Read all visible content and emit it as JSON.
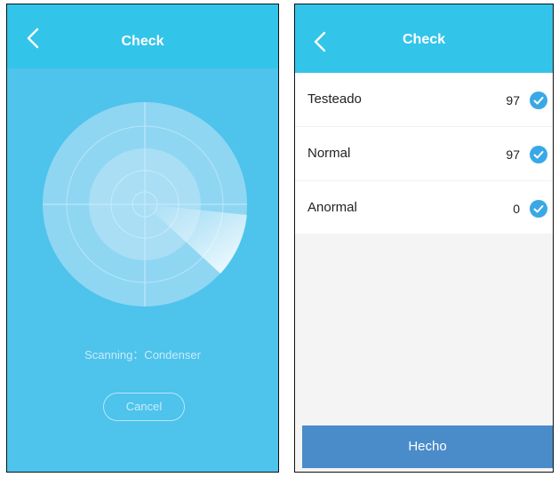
{
  "theme": {
    "header_color": "#33c4ea",
    "scan_bg_color": "#4ec3ec",
    "check_color": "#3aa8e6",
    "done_button_color": "#4a8cc9"
  },
  "scan_screen": {
    "back_icon": "chevron-left-icon",
    "title": "Check",
    "status_text": "Scanning：Condenser",
    "cancel_label": "Cancel"
  },
  "result_screen": {
    "back_icon": "chevron-left-icon",
    "title": "Check",
    "rows": [
      {
        "label": "Testeado",
        "value": "97",
        "icon": "check-circle-icon"
      },
      {
        "label": "Normal",
        "value": "97",
        "icon": "check-circle-icon"
      },
      {
        "label": "Anormal",
        "value": "0",
        "icon": "check-circle-icon"
      }
    ],
    "done_label": "Hecho"
  }
}
